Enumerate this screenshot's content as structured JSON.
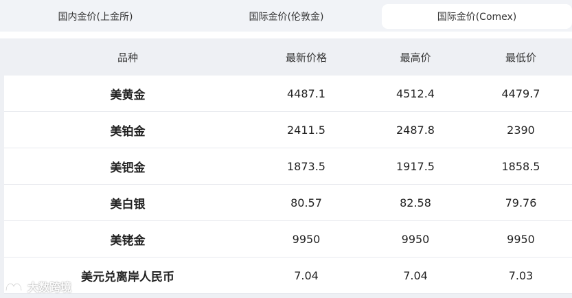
{
  "tabs": [
    {
      "label": "国内金价(上金所)",
      "active": false
    },
    {
      "label": "国际金价(伦敦金)",
      "active": false
    },
    {
      "label": "国际金价(Comex)",
      "active": true
    }
  ],
  "table": {
    "headers": [
      "品种",
      "最新价格",
      "最高价",
      "最低价"
    ],
    "rows": [
      {
        "name": "美黄金",
        "latest": "4487.1",
        "high": "4512.4",
        "low": "4479.7"
      },
      {
        "name": "美铂金",
        "latest": "2411.5",
        "high": "2487.8",
        "low": "2390"
      },
      {
        "name": "美钯金",
        "latest": "1873.5",
        "high": "1917.5",
        "low": "1858.5"
      },
      {
        "name": "美白银",
        "latest": "80.57",
        "high": "82.58",
        "low": "79.76"
      },
      {
        "name": "美铑金",
        "latest": "9950",
        "high": "9950",
        "low": "9950"
      },
      {
        "name": "美元兑离岸人民币",
        "latest": "7.04",
        "high": "7.04",
        "low": "7.03"
      }
    ]
  },
  "watermark": {
    "text": "大数跨境",
    "icon": "brand-logo-icon"
  },
  "colors": {
    "tabbar_bg": "#f1f3f7",
    "active_tab_bg": "#ffffff",
    "panel_bg": "#eef0f4",
    "row_bg": "#ffffff"
  }
}
